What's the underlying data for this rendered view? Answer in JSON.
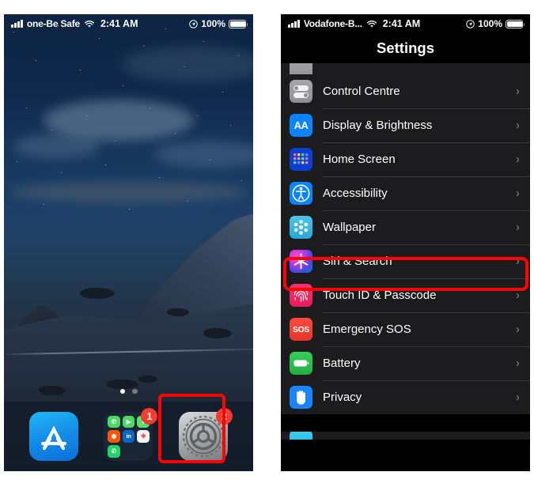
{
  "home_phone": {
    "status_bar": {
      "signal_icon": "signal-bars-icon",
      "carrier": "one-Be Safe",
      "wifi_icon": "wifi-icon",
      "time": "2:41 AM",
      "location_icon": "location-arrow-icon",
      "battery_percent": "100%",
      "battery_icon": "battery-full-icon"
    },
    "page_dots": {
      "count": 2,
      "active_index": 0
    },
    "dock": {
      "items": [
        {
          "name": "app-store",
          "label": "App Store",
          "icon": "app-store-icon",
          "badge": null
        },
        {
          "name": "social-folder",
          "label": "Folder",
          "icon": "folder-icon",
          "badge": "1"
        },
        {
          "name": "settings",
          "label": "Settings",
          "icon": "gear-icon",
          "badge": "2"
        }
      ],
      "folder_mini_icons": [
        {
          "name": "phone",
          "color": "#4cd964",
          "glyph": "✆"
        },
        {
          "name": "facetime",
          "color": "#4cd964",
          "glyph": "▶"
        },
        {
          "name": "messages",
          "color": "#4cd964",
          "glyph": "●"
        },
        {
          "name": "reddit",
          "color": "#ff5700",
          "glyph": "◉"
        },
        {
          "name": "linkedin",
          "color": "#0a66c2",
          "glyph": "in"
        },
        {
          "name": "photos",
          "color": "#f2f2f2",
          "glyph": "❀"
        },
        {
          "name": "whatsapp",
          "color": "#25d366",
          "glyph": "✆"
        }
      ]
    },
    "highlight": {
      "target": "settings-app-icon",
      "color": "#fb0404"
    }
  },
  "settings_phone": {
    "status_bar": {
      "signal_icon": "signal-bars-icon",
      "carrier": "Vodafone-B...",
      "wifi_icon": "wifi-icon",
      "time": "2:41 AM",
      "location_icon": "location-arrow-icon",
      "battery_percent": "100%",
      "battery_icon": "battery-full-icon"
    },
    "nav_title": "Settings",
    "chevron": "›",
    "rows_partial_top": {
      "label": "",
      "icon": "general-icon"
    },
    "rows": [
      {
        "label": "Control Centre",
        "icon": "control-centre-icon",
        "icon_class": "ic-ctrl",
        "highlighted": false
      },
      {
        "label": "Display & Brightness",
        "icon": "display-brightness-icon",
        "icon_class": "ic-aa",
        "highlighted": false
      },
      {
        "label": "Home Screen",
        "icon": "home-screen-icon",
        "icon_class": "ic-home",
        "highlighted": false
      },
      {
        "label": "Accessibility",
        "icon": "accessibility-icon",
        "icon_class": "ic-access",
        "highlighted": false
      },
      {
        "label": "Wallpaper",
        "icon": "wallpaper-icon",
        "icon_class": "ic-wall",
        "highlighted": false
      },
      {
        "label": "Siri & Search",
        "icon": "siri-search-icon",
        "icon_class": "ic-siri",
        "highlighted": true
      },
      {
        "label": "Touch ID & Passcode",
        "icon": "touch-id-icon",
        "icon_class": "ic-touch",
        "highlighted": false
      },
      {
        "label": "Emergency SOS",
        "icon": "emergency-sos-icon",
        "icon_class": "ic-sos",
        "highlighted": false
      },
      {
        "label": "Battery",
        "icon": "battery-icon",
        "icon_class": "ic-batt",
        "highlighted": false
      },
      {
        "label": "Privacy",
        "icon": "privacy-icon",
        "icon_class": "ic-privacy",
        "highlighted": false
      }
    ],
    "rows_partial_bottom": {
      "label": "",
      "icon": "app-store-settings-icon"
    },
    "highlight": {
      "target": "siri-and-search-row",
      "color": "#fb0404"
    }
  },
  "colors": {
    "highlight": "#fb0404",
    "badge": "#ff3b30",
    "row_bg": "#1c1c1e",
    "screen_bg": "#000000",
    "separator": "#38383a",
    "chevron": "#6c6c70"
  }
}
